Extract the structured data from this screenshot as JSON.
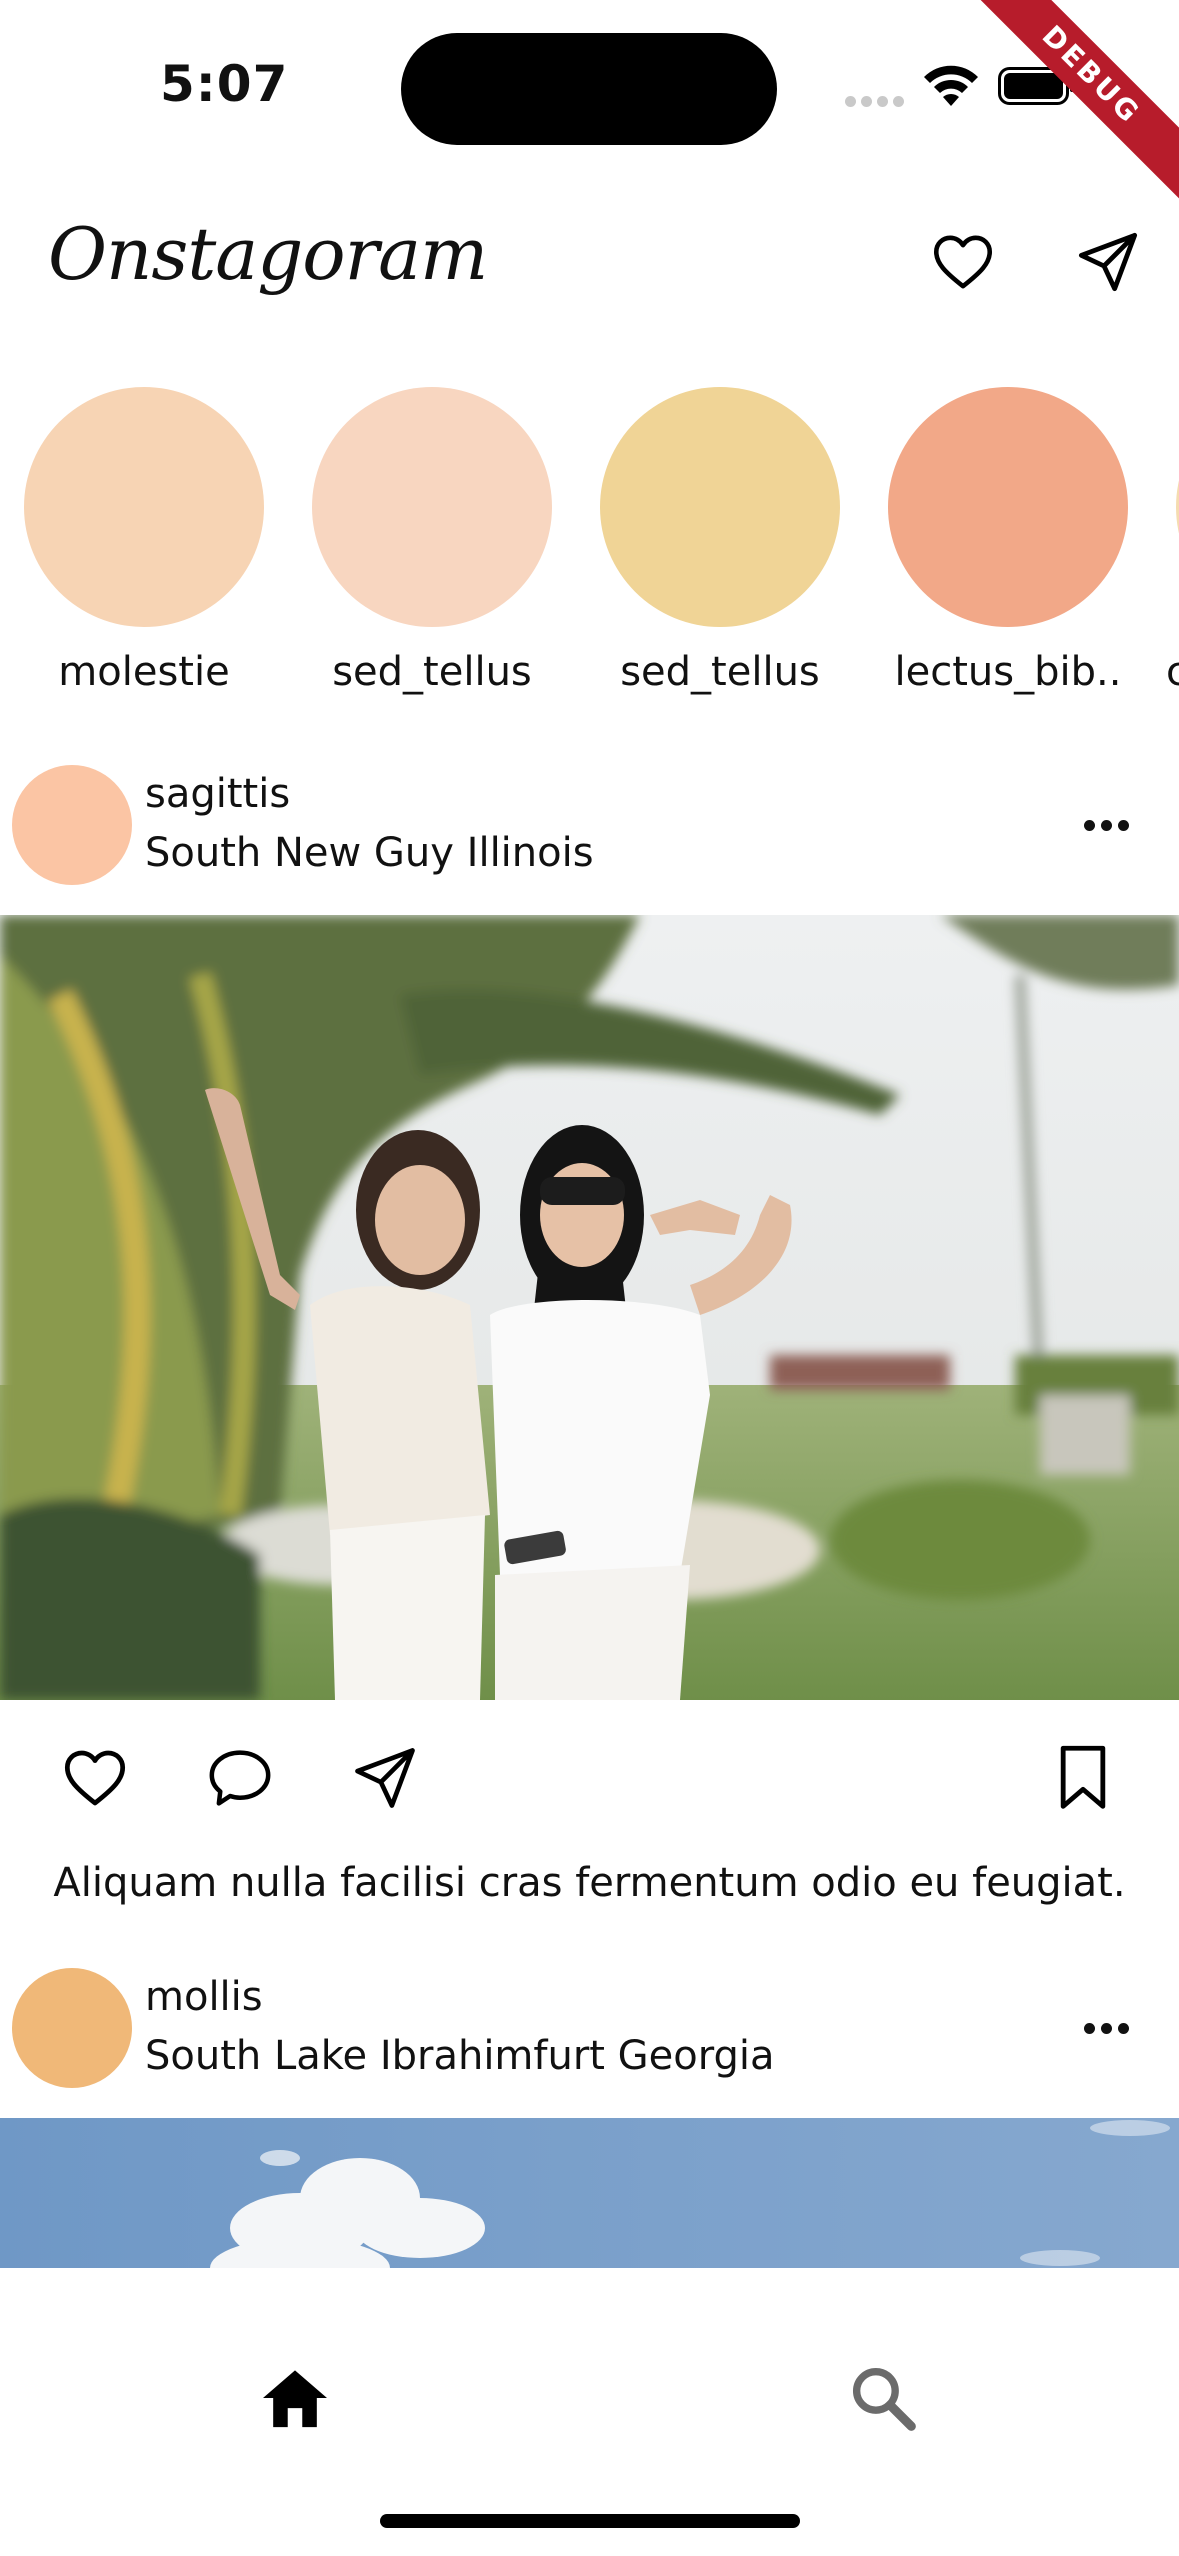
{
  "status_bar": {
    "time": "5:07",
    "debug_label": "DEBUG"
  },
  "app_bar": {
    "title": "Onstagoram"
  },
  "stories": [
    {
      "name": "molestie",
      "color": "#f7d4b4"
    },
    {
      "name": "sed_tellus",
      "color": "#f8d6c0"
    },
    {
      "name": "sed_tellus",
      "color": "#f0d496"
    },
    {
      "name": "lectus_bib..",
      "color": "#f2a888"
    },
    {
      "name": "c",
      "color": "#f5dcb0"
    }
  ],
  "posts": [
    {
      "username": "sagittis",
      "location": "South New Guy Illinois",
      "avatar_color": "#fbc5a4",
      "caption": "Aliquam nulla facilisi cras fermentum odio eu feugiat."
    },
    {
      "username": "mollis",
      "location": "South Lake Ibrahimfurt Georgia",
      "avatar_color": "#f0b878"
    }
  ],
  "icons": {
    "appbar": [
      "heart-icon",
      "send-icon"
    ],
    "post_actions": [
      "heart-icon",
      "comment-icon",
      "send-icon",
      "bookmark-icon"
    ],
    "bottom_nav": [
      "home-icon",
      "search-icon"
    ]
  }
}
